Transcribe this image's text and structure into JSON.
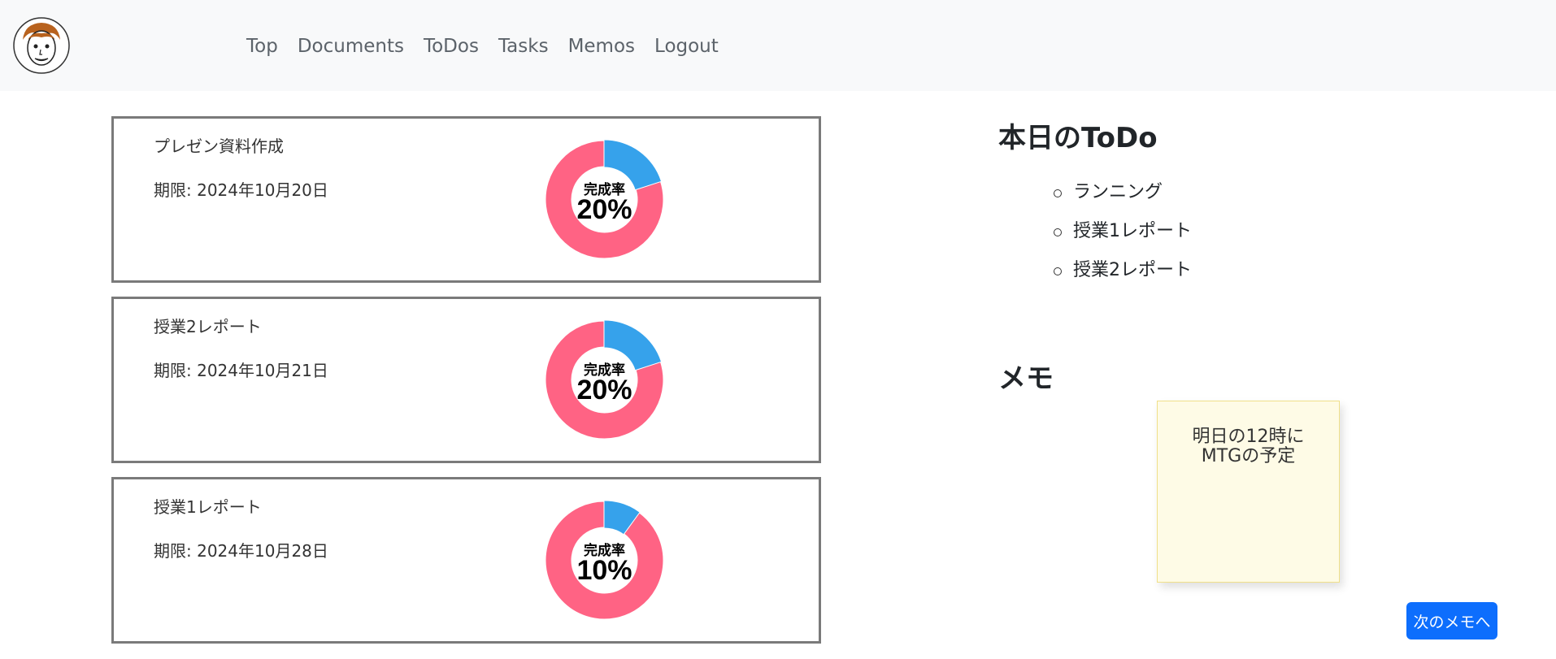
{
  "nav": {
    "links": [
      "Top",
      "Documents",
      "ToDos",
      "Tasks",
      "Memos",
      "Logout"
    ]
  },
  "tasks": [
    {
      "title": "プレゼン資料作成",
      "deadline": "期限: 2024年10月20日",
      "progress_label": "完成率",
      "progress_text": "20%",
      "progress": 0.2
    },
    {
      "title": "授業2レポート",
      "deadline": "期限: 2024年10月21日",
      "progress_label": "完成率",
      "progress_text": "20%",
      "progress": 0.2
    },
    {
      "title": "授業1レポート",
      "deadline": "期限: 2024年10月28日",
      "progress_label": "完成率",
      "progress_text": "10%",
      "progress": 0.1
    }
  ],
  "colors": {
    "done": "#36a2eb",
    "remaining": "#ff6384",
    "accent": "#0d6efd"
  },
  "todo": {
    "title": "本日のToDo",
    "items": [
      "ランニング",
      "授業1レポート",
      "授業2レポート"
    ]
  },
  "memo": {
    "title": "メモ",
    "lines": [
      "明日の12時に",
      "MTGの予定"
    ],
    "next_label": "次のメモへ"
  }
}
